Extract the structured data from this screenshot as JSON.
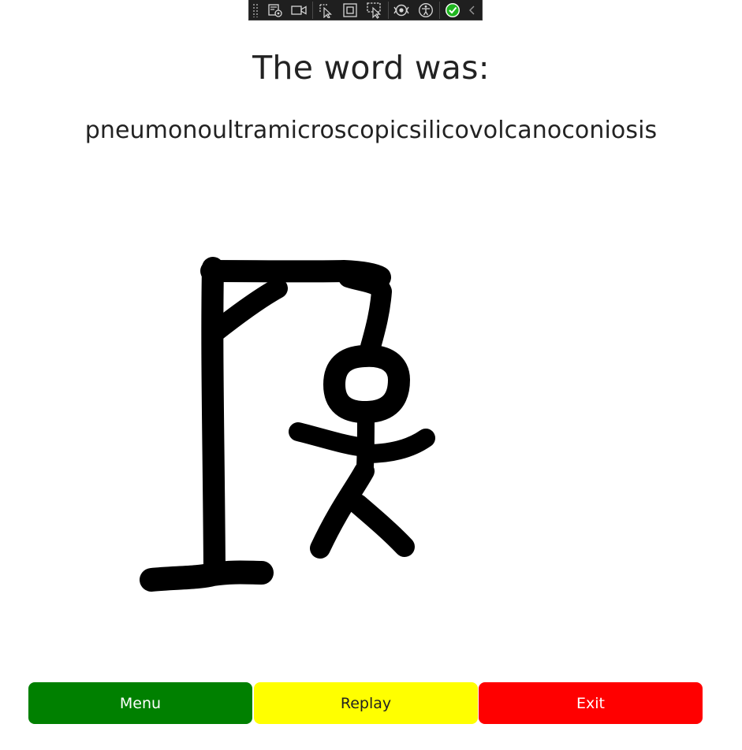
{
  "toolbar": {
    "icons": [
      "live-visual-tree-icon",
      "video-icon",
      "select-element-icon",
      "display-layout-adorners-icon",
      "track-focused-element-icon",
      "hot-reload-icon",
      "accessibility-icon",
      "check-circle-icon",
      "collapse-chevron-icon"
    ],
    "accent": "#1fb51f"
  },
  "result": {
    "title": "The word was:",
    "word": "pneumonoultramicroscopicsilicovolcanoconiosis"
  },
  "buttons": {
    "menu": "Menu",
    "replay": "Replay",
    "exit": "Exit"
  },
  "colors": {
    "menu": "#008000",
    "replay": "#ffff00",
    "exit": "#ff0000",
    "ink": "#000000"
  }
}
